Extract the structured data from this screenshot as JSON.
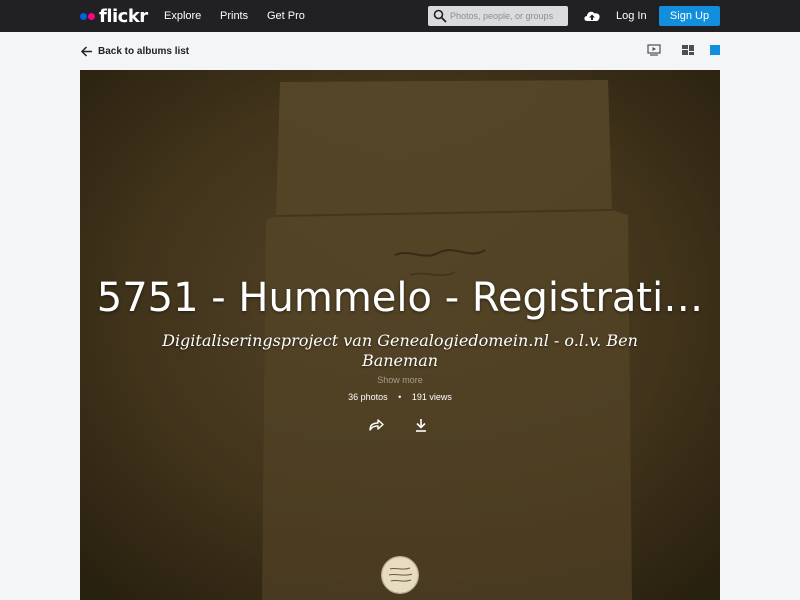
{
  "brand": {
    "name": "flickr",
    "colors": {
      "blue": "#0063dc",
      "pink": "#ff0084",
      "accent": "#128fdc",
      "topbar": "#212124"
    }
  },
  "nav": {
    "links": [
      {
        "label": "Explore"
      },
      {
        "label": "Prints"
      },
      {
        "label": "Get Pro"
      }
    ],
    "search": {
      "placeholder": "Photos, people, or groups",
      "value": ""
    },
    "login_label": "Log In",
    "signup_label": "Sign Up"
  },
  "subbar": {
    "back_label": "Back to albums list",
    "icons": [
      "slideshow-icon",
      "grid-view-icon",
      "single-view-icon"
    ]
  },
  "album": {
    "title": "5751 - Hummelo - Registrati…",
    "description": "Digitaliseringsproject van Genealogiedomein.nl - o.l.v. Ben Baneman",
    "show_more": "Show more",
    "photos": "36 photos",
    "stats_separator": "•",
    "views": "191 views",
    "actions": [
      "share-icon",
      "download-icon"
    ]
  }
}
